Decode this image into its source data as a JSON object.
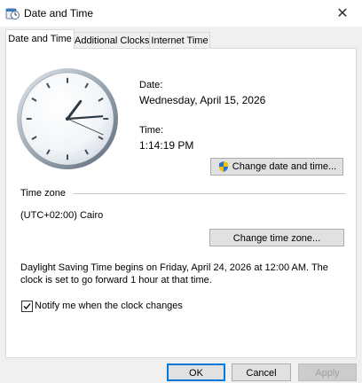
{
  "window": {
    "title": "Date and Time",
    "close_icon": "close-icon"
  },
  "tabs": [
    {
      "label": "Date and Time",
      "active": true
    },
    {
      "label": "Additional Clocks",
      "active": false
    },
    {
      "label": "Internet Time",
      "active": false
    }
  ],
  "datetime": {
    "date_label": "Date:",
    "date_value": "Wednesday, April 15, 2026",
    "time_label": "Time:",
    "time_value": "1:14:19 PM",
    "change_button": "Change date and time...",
    "clock_hours": 1,
    "clock_minutes": 14,
    "clock_seconds": 19
  },
  "timezone": {
    "group_label": "Time zone",
    "value": "(UTC+02:00) Cairo",
    "change_button": "Change time zone..."
  },
  "dst": {
    "message": "Daylight Saving Time begins on Friday, April 24, 2026 at 12:00 AM. The clock is set to go forward 1 hour at that time."
  },
  "notify": {
    "label": "Notify me when the clock changes",
    "checked": true
  },
  "footer": {
    "ok": "OK",
    "cancel": "Cancel",
    "apply": "Apply"
  }
}
